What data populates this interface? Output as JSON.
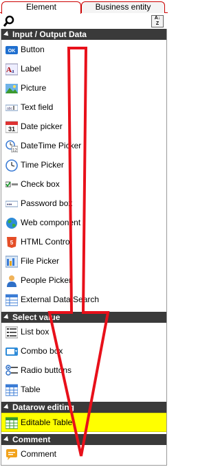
{
  "tabs": {
    "element": "Element",
    "business_entity": "Business entity"
  },
  "sections": {
    "io": "Input / Output Data",
    "select": "Select value",
    "datarow": "Datarow editing",
    "comment": "Comment"
  },
  "io_items": [
    {
      "label": "Button",
      "icon": "button-icon"
    },
    {
      "label": "Label",
      "icon": "label-icon"
    },
    {
      "label": "Picture",
      "icon": "picture-icon"
    },
    {
      "label": "Text field",
      "icon": "text-field-icon"
    },
    {
      "label": "Date picker",
      "icon": "calendar-icon"
    },
    {
      "label": "DateTime Picker",
      "icon": "datetime-icon"
    },
    {
      "label": "Time Picker",
      "icon": "clock-icon"
    },
    {
      "label": "Check box",
      "icon": "checkbox-icon"
    },
    {
      "label": "Password box",
      "icon": "password-icon"
    },
    {
      "label": "Web component",
      "icon": "globe-icon"
    },
    {
      "label": "HTML Control",
      "icon": "html5-icon"
    },
    {
      "label": "File Picker",
      "icon": "file-picker-icon"
    },
    {
      "label": "People Picker",
      "icon": "person-icon"
    },
    {
      "label": "External Data Search",
      "icon": "data-search-icon"
    }
  ],
  "select_items": [
    {
      "label": "List box",
      "icon": "list-box-icon"
    },
    {
      "label": "Combo box",
      "icon": "combo-box-icon"
    },
    {
      "label": "Radio buttons",
      "icon": "radio-buttons-icon"
    },
    {
      "label": "Table",
      "icon": "table-icon"
    }
  ],
  "datarow_items": [
    {
      "label": "Editable Table",
      "icon": "editable-table-icon"
    }
  ],
  "comment_items": [
    {
      "label": "Comment",
      "icon": "comment-icon"
    }
  ],
  "colors": {
    "highlight": "#ffff00",
    "section_bg": "#3a3a3a",
    "arrow": "#e8101a",
    "tab_border": "#cc0000"
  }
}
